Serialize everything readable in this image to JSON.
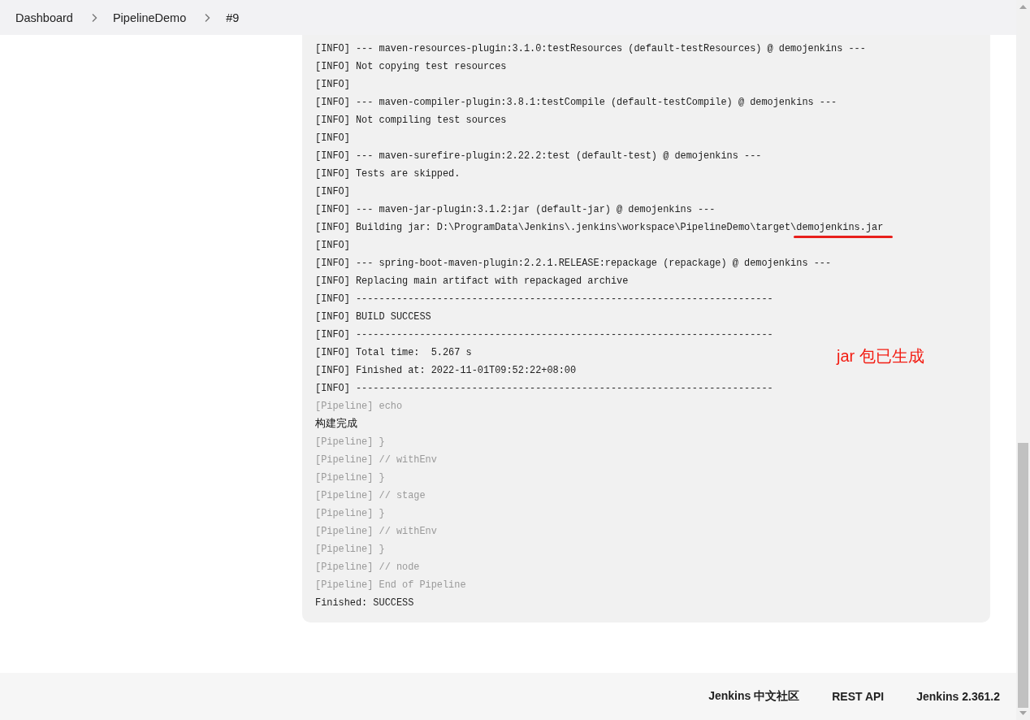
{
  "breadcrumb": [
    {
      "label": "Dashboard"
    },
    {
      "label": "PipelineDemo"
    },
    {
      "label": "#9"
    }
  ],
  "console": {
    "lines": [
      {
        "kind": "info",
        "text": "[INFO] --- maven-resources-plugin:3.1.0:testResources (default-testResources) @ demojenkins ---"
      },
      {
        "kind": "info",
        "text": "[INFO] Not copying test resources"
      },
      {
        "kind": "info",
        "text": "[INFO]"
      },
      {
        "kind": "info",
        "text": "[INFO] --- maven-compiler-plugin:3.8.1:testCompile (default-testCompile) @ demojenkins ---"
      },
      {
        "kind": "info",
        "text": "[INFO] Not compiling test sources"
      },
      {
        "kind": "info",
        "text": "[INFO]"
      },
      {
        "kind": "info",
        "text": "[INFO] --- maven-surefire-plugin:2.22.2:test (default-test) @ demojenkins ---"
      },
      {
        "kind": "info",
        "text": "[INFO] Tests are skipped."
      },
      {
        "kind": "info",
        "text": "[INFO]"
      },
      {
        "kind": "info",
        "text": "[INFO] --- maven-jar-plugin:3.1.2:jar (default-jar) @ demojenkins ---"
      },
      {
        "kind": "info",
        "text": "[INFO] Building jar: D:\\ProgramData\\Jenkins\\.jenkins\\workspace\\PipelineDemo\\target\\",
        "highlight": "demojenkins.jar"
      },
      {
        "kind": "info",
        "text": "[INFO]"
      },
      {
        "kind": "info",
        "text": "[INFO] --- spring-boot-maven-plugin:2.2.1.RELEASE:repackage (repackage) @ demojenkins ---"
      },
      {
        "kind": "info",
        "text": "[INFO] Replacing main artifact with repackaged archive"
      },
      {
        "kind": "info",
        "text": "[INFO] ------------------------------------------------------------------------"
      },
      {
        "kind": "info",
        "text": "[INFO] BUILD SUCCESS"
      },
      {
        "kind": "info",
        "text": "[INFO] ------------------------------------------------------------------------"
      },
      {
        "kind": "info",
        "text": "[INFO] Total time:  5.267 s"
      },
      {
        "kind": "info",
        "text": "[INFO] Finished at: 2022-11-01T09:52:22+08:00"
      },
      {
        "kind": "info",
        "text": "[INFO] ------------------------------------------------------------------------"
      },
      {
        "kind": "pipeline",
        "text": "[Pipeline] echo"
      },
      {
        "kind": "output",
        "text": "构建完成"
      },
      {
        "kind": "pipeline",
        "text": "[Pipeline] }"
      },
      {
        "kind": "pipeline",
        "text": "[Pipeline] // withEnv"
      },
      {
        "kind": "pipeline",
        "text": "[Pipeline] }"
      },
      {
        "kind": "pipeline",
        "text": "[Pipeline] // stage"
      },
      {
        "kind": "pipeline",
        "text": "[Pipeline] }"
      },
      {
        "kind": "pipeline",
        "text": "[Pipeline] // withEnv"
      },
      {
        "kind": "pipeline",
        "text": "[Pipeline] }"
      },
      {
        "kind": "pipeline",
        "text": "[Pipeline] // node"
      },
      {
        "kind": "pipeline",
        "text": "[Pipeline] End of Pipeline"
      },
      {
        "kind": "info",
        "text": "Finished: SUCCESS"
      }
    ],
    "annotation": "jar 包已生成"
  },
  "footer": {
    "links": [
      {
        "label": "Jenkins 中文社区"
      },
      {
        "label": "REST API"
      },
      {
        "label": "Jenkins 2.361.2"
      }
    ]
  }
}
